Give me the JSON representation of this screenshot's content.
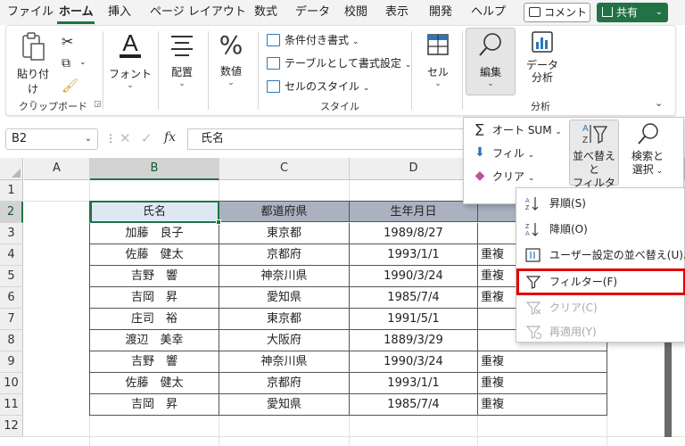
{
  "menu_tabs": [
    "ファイル",
    "ホーム",
    "挿入",
    "ページ レイアウト",
    "数式",
    "データ",
    "校閲",
    "表示",
    "開発",
    "ヘルプ"
  ],
  "active_tab": "ホーム",
  "comment_label": "コメント",
  "share_label": "共有",
  "ribbon": {
    "clipboard": {
      "paste": "貼り付け",
      "group_label": "クリップボード"
    },
    "font": {
      "label": "フォント"
    },
    "alignment": {
      "label": "配置"
    },
    "number": {
      "label": "数値"
    },
    "styles": {
      "conditional": "条件付き書式",
      "as_table": "テーブルとして書式設定",
      "cell_styles": "セルのスタイル",
      "group_label": "スタイル"
    },
    "cells": {
      "label": "セル"
    },
    "editing": {
      "label": "編集"
    },
    "analyze": {
      "label_line1": "データ",
      "label_line2": "分析",
      "group_label": "分析"
    }
  },
  "formula_bar": {
    "name_box": "B2",
    "fx": "fx",
    "content": "氏名"
  },
  "columns": [
    "A",
    "B",
    "C",
    "D"
  ],
  "rows": [
    "1",
    "2",
    "3",
    "4",
    "5",
    "6",
    "7",
    "8",
    "9",
    "10",
    "11",
    "12"
  ],
  "table": {
    "headers": [
      "氏名",
      "都道府県",
      "生年月日"
    ],
    "data": [
      [
        "加藤　良子",
        "東京都",
        "1989/8/27",
        ""
      ],
      [
        "佐藤　健太",
        "京都府",
        "1993/1/1",
        "重複"
      ],
      [
        "吉野　響",
        "神奈川県",
        "1990/3/24",
        "重複"
      ],
      [
        "吉岡　昇",
        "愛知県",
        "1985/7/4",
        "重複"
      ],
      [
        "庄司　裕",
        "東京都",
        "1991/5/1",
        ""
      ],
      [
        "渡辺　美幸",
        "大阪府",
        "1889/3/29",
        ""
      ],
      [
        "吉野　響",
        "神奈川県",
        "1990/3/24",
        "重複"
      ],
      [
        "佐藤　健太",
        "京都府",
        "1993/1/1",
        "重複"
      ],
      [
        "吉岡　昇",
        "愛知県",
        "1985/7/4",
        "重複"
      ]
    ]
  },
  "editing_menu": {
    "autosum": "オート SUM",
    "fill": "フィル",
    "clear": "クリア",
    "sort_filter_line1": "並べ替えと",
    "sort_filter_line2": "フィルター",
    "find_select_line1": "検索と",
    "find_select_line2": "選択"
  },
  "sort_filter_menu": [
    {
      "label": "昇順(S)",
      "disabled": false
    },
    {
      "label": "降順(O)",
      "disabled": false
    },
    {
      "label": "ユーザー設定の並べ替え(U)...",
      "disabled": false
    },
    {
      "label": "フィルター(F)",
      "disabled": false,
      "highlighted": true
    },
    {
      "label": "クリア(C)",
      "disabled": true
    },
    {
      "label": "再適用(Y)",
      "disabled": true
    }
  ],
  "colors": {
    "accent": "#217346",
    "highlight_box": "#e00000",
    "header_fill": "#aab2c0",
    "header_fill_selected": "#dde8f4"
  }
}
